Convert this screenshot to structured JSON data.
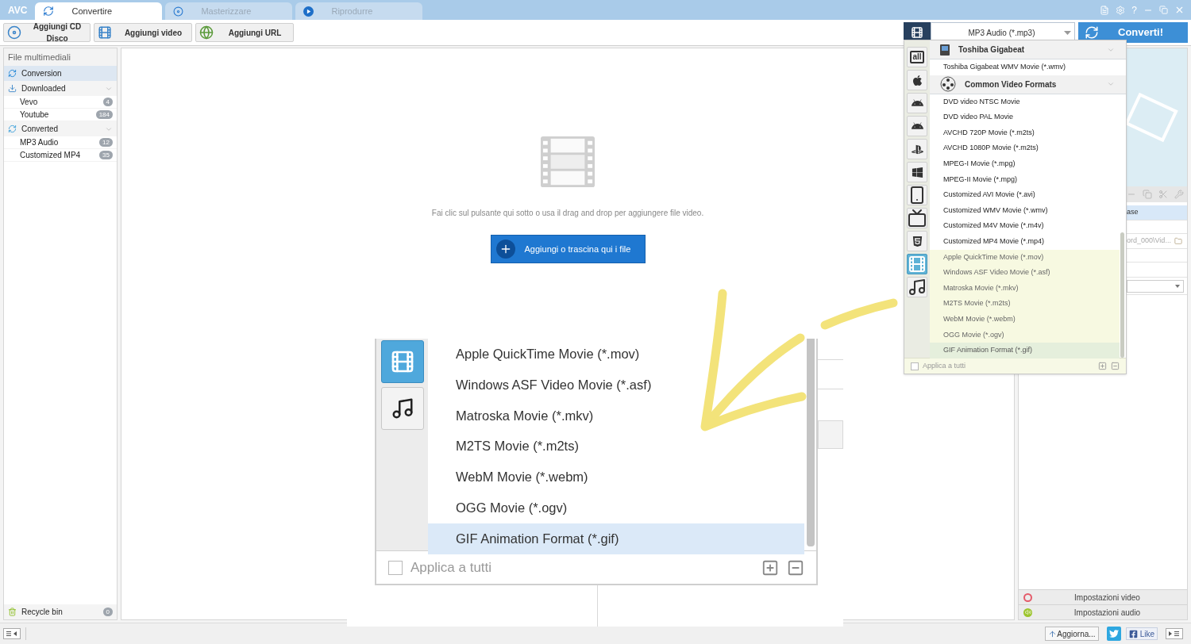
{
  "app": {
    "logo": "AVC"
  },
  "tabs": [
    {
      "label": "Convertire",
      "selected": true
    },
    {
      "label": "Masterizzare",
      "selected": false
    },
    {
      "label": "Riprodurre",
      "selected": false
    }
  ],
  "window_controls": {
    "help": "?"
  },
  "toolbar": {
    "buttons": [
      "Aggiungi CD Disco",
      "Aggiungi video",
      "Aggiungi URL"
    ],
    "format_select": {
      "value": "MP3 Audio (*.mp3)"
    },
    "convert_button": "Converti!"
  },
  "sidebar": {
    "header": "File multimediali",
    "groups": [
      {
        "label": "Conversion",
        "selected": true
      },
      {
        "label": "Downloaded",
        "selected": false,
        "children": [
          {
            "label": "Vevo",
            "count": "4"
          },
          {
            "label": "Youtube",
            "count": "184"
          }
        ]
      },
      {
        "label": "Converted",
        "selected": false,
        "children": [
          {
            "label": "MP3 Audio",
            "count": "12"
          },
          {
            "label": "Customized MP4",
            "count": "35"
          }
        ]
      }
    ],
    "recycle_bin": {
      "label": "Recycle bin",
      "count": "0"
    }
  },
  "drop_area": {
    "hint": "Fai clic sul pulsante qui sotto o usa il drag and drop per aggiungere file video.",
    "button": "Aggiungi o trascina qui i file"
  },
  "format_dropdown": {
    "categories": [
      {
        "label": "all",
        "selected": false
      },
      {
        "selected": false
      },
      {
        "selected": false
      },
      {
        "selected": false
      },
      {
        "selected": false
      },
      {
        "selected": false
      },
      {
        "selected": false
      },
      {
        "selected": false
      },
      {
        "selected": false
      },
      {
        "selected": true
      },
      {
        "selected": false
      }
    ],
    "items": [
      {
        "kind": "group",
        "label": "Toshiba Gigabeat"
      },
      {
        "kind": "format",
        "label": "Toshiba Gigabeat WMV Movie (*.wmv)",
        "highlighted": false,
        "selected": false
      },
      {
        "kind": "group",
        "label": "Common Video Formats"
      },
      {
        "kind": "format",
        "label": "DVD video NTSC Movie",
        "highlighted": false,
        "selected": false
      },
      {
        "kind": "format",
        "label": "DVD video PAL Movie",
        "highlighted": false,
        "selected": false
      },
      {
        "kind": "format",
        "label": "AVCHD 720P Movie (*.m2ts)",
        "highlighted": false,
        "selected": false
      },
      {
        "kind": "format",
        "label": "AVCHD 1080P Movie (*.m2ts)",
        "highlighted": false,
        "selected": false
      },
      {
        "kind": "format",
        "label": "MPEG-I Movie (*.mpg)",
        "highlighted": false,
        "selected": false
      },
      {
        "kind": "format",
        "label": "MPEG-II Movie (*.mpg)",
        "highlighted": false,
        "selected": false
      },
      {
        "kind": "format",
        "label": "Customized AVI Movie (*.avi)",
        "highlighted": false,
        "selected": false
      },
      {
        "kind": "format",
        "label": "Customized WMV Movie (*.wmv)",
        "highlighted": false,
        "selected": false
      },
      {
        "kind": "format",
        "label": "Customized M4V Movie (*.m4v)",
        "highlighted": false,
        "selected": false
      },
      {
        "kind": "format",
        "label": "Customized MP4 Movie (*.mp4)",
        "highlighted": false,
        "selected": false
      },
      {
        "kind": "format",
        "label": "Apple QuickTime Movie (*.mov)",
        "highlighted": true,
        "selected": false
      },
      {
        "kind": "format",
        "label": "Windows ASF Video Movie (*.asf)",
        "highlighted": true,
        "selected": false
      },
      {
        "kind": "format",
        "label": "Matroska Movie (*.mkv)",
        "highlighted": true,
        "selected": false
      },
      {
        "kind": "format",
        "label": "M2TS Movie (*.m2ts)",
        "highlighted": true,
        "selected": false
      },
      {
        "kind": "format",
        "label": "WebM Movie (*.webm)",
        "highlighted": true,
        "selected": false
      },
      {
        "kind": "format",
        "label": "OGG Movie (*.ogv)",
        "highlighted": true,
        "selected": false
      },
      {
        "kind": "format",
        "label": "GIF Animation Format (*.gif)",
        "highlighted": true,
        "selected": true
      }
    ],
    "apply_all": {
      "label": "Applica a tutti",
      "checked": false
    }
  },
  "zoom_callout": {
    "categories": [
      {
        "selected": true
      },
      {
        "selected": false
      }
    ],
    "items": [
      {
        "label": "Apple QuickTime Movie (*.mov)",
        "selected": false
      },
      {
        "label": "Windows ASF Video Movie (*.asf)",
        "selected": false
      },
      {
        "label": "Matroska Movie (*.mkv)",
        "selected": false
      },
      {
        "label": "M2TS Movie (*.m2ts)",
        "selected": false
      },
      {
        "label": "WebM Movie (*.webm)",
        "selected": false
      },
      {
        "label": "OGG Movie (*.ogv)",
        "selected": false
      },
      {
        "label": "GIF Animation Format (*.gif)",
        "selected": true
      }
    ],
    "apply_all": {
      "label": "Applica a tutti",
      "checked": false
    }
  },
  "right_panel": {
    "rows": [
      {
        "text": "ase",
        "selected": true
      },
      {
        "text": "ord_000\\Vid...",
        "selected": false
      }
    ],
    "buttons": [
      "Impostazioni video",
      "Impostazioni audio"
    ]
  },
  "status_bar": {
    "update_button": "Aggiorna...",
    "like_button": "Like"
  }
}
